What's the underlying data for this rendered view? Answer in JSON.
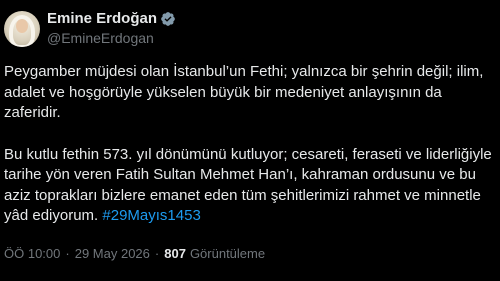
{
  "author": {
    "display_name": "Emine Erdoğan",
    "handle": "@EmineErdogan",
    "verified_badge_color": "#829aab"
  },
  "tweet": {
    "paragraph_1": "Peygamber müjdesi olan İstanbul’un Fethi; yalnızca bir şehrin değil; ilim, adalet ve hoşgörüyle yükselen büyük bir medeniyet anlayışının da zaferidir.",
    "paragraph_2": "Bu kutlu fethin 573. yıl dönümünü kutluyor; cesareti, feraseti ve liderliğiyle tarihe yön veren Fatih Sultan Mehmet Han’ı, kahraman ordusunu ve bu aziz toprakları bizlere emanet eden tüm şehitlerimizi rahmet ve minnetle yâd ediyorum.",
    "hashtag": "#29Mayıs1453"
  },
  "meta": {
    "time": "ÖÖ 10:00",
    "separator": "·",
    "date": "29 May 2026",
    "views_count": "807",
    "views_label": "Görüntüleme"
  },
  "colors": {
    "background": "#000000",
    "text_primary": "#e7e9ea",
    "text_secondary": "#71767b",
    "link": "#1d9bf0"
  }
}
